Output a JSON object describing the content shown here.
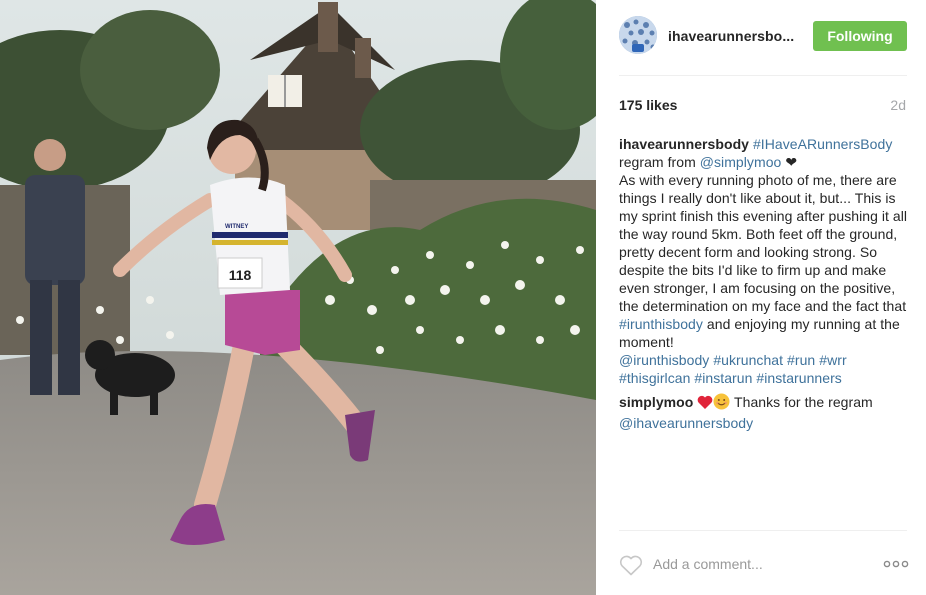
{
  "post": {
    "author": "ihavearunnersbo...",
    "follow_button": "Following",
    "likes": "175 likes",
    "time_ago": "2d",
    "caption": {
      "username": "ihavearunnersbody",
      "hashtag_title": "#IHaveARunnersBody",
      "regram_prefix": "regram from",
      "regram_user": "@simplymoo",
      "regram_suffix": "❤",
      "body": "As with every running photo of me, there are things I really don't like about it, but... This is my sprint finish this evening after pushing it all the way round 5km. Both feet off the ground, pretty decent form and looking strong. So despite the bits I'd like to firm up and make even stronger, I am focusing on the positive, the determination on my face and the fact that",
      "tag_inline": "#irunthisbody",
      "body_end": "and enjoying my running at the moment!",
      "tags": [
        "@irunthisbody",
        "#ukrunchat",
        "#run",
        "#wrr",
        "#thisgirlcan",
        "#instarun",
        "#instarunners"
      ]
    },
    "comment": {
      "username": "simplymoo",
      "text": "Thanks for the regram",
      "mention": "@ihavearunnersbody"
    },
    "add_comment_placeholder": "Add a comment...",
    "photo": {
      "bib_number": "118",
      "vest_text": "WITNEY"
    },
    "icons": {
      "like": "heart-outline-icon",
      "more": "more-options-icon",
      "avatar": "profile-avatar"
    },
    "colors": {
      "following_button": "#70c050",
      "link": "#3f729b",
      "muted": "#a5a7aa"
    }
  }
}
